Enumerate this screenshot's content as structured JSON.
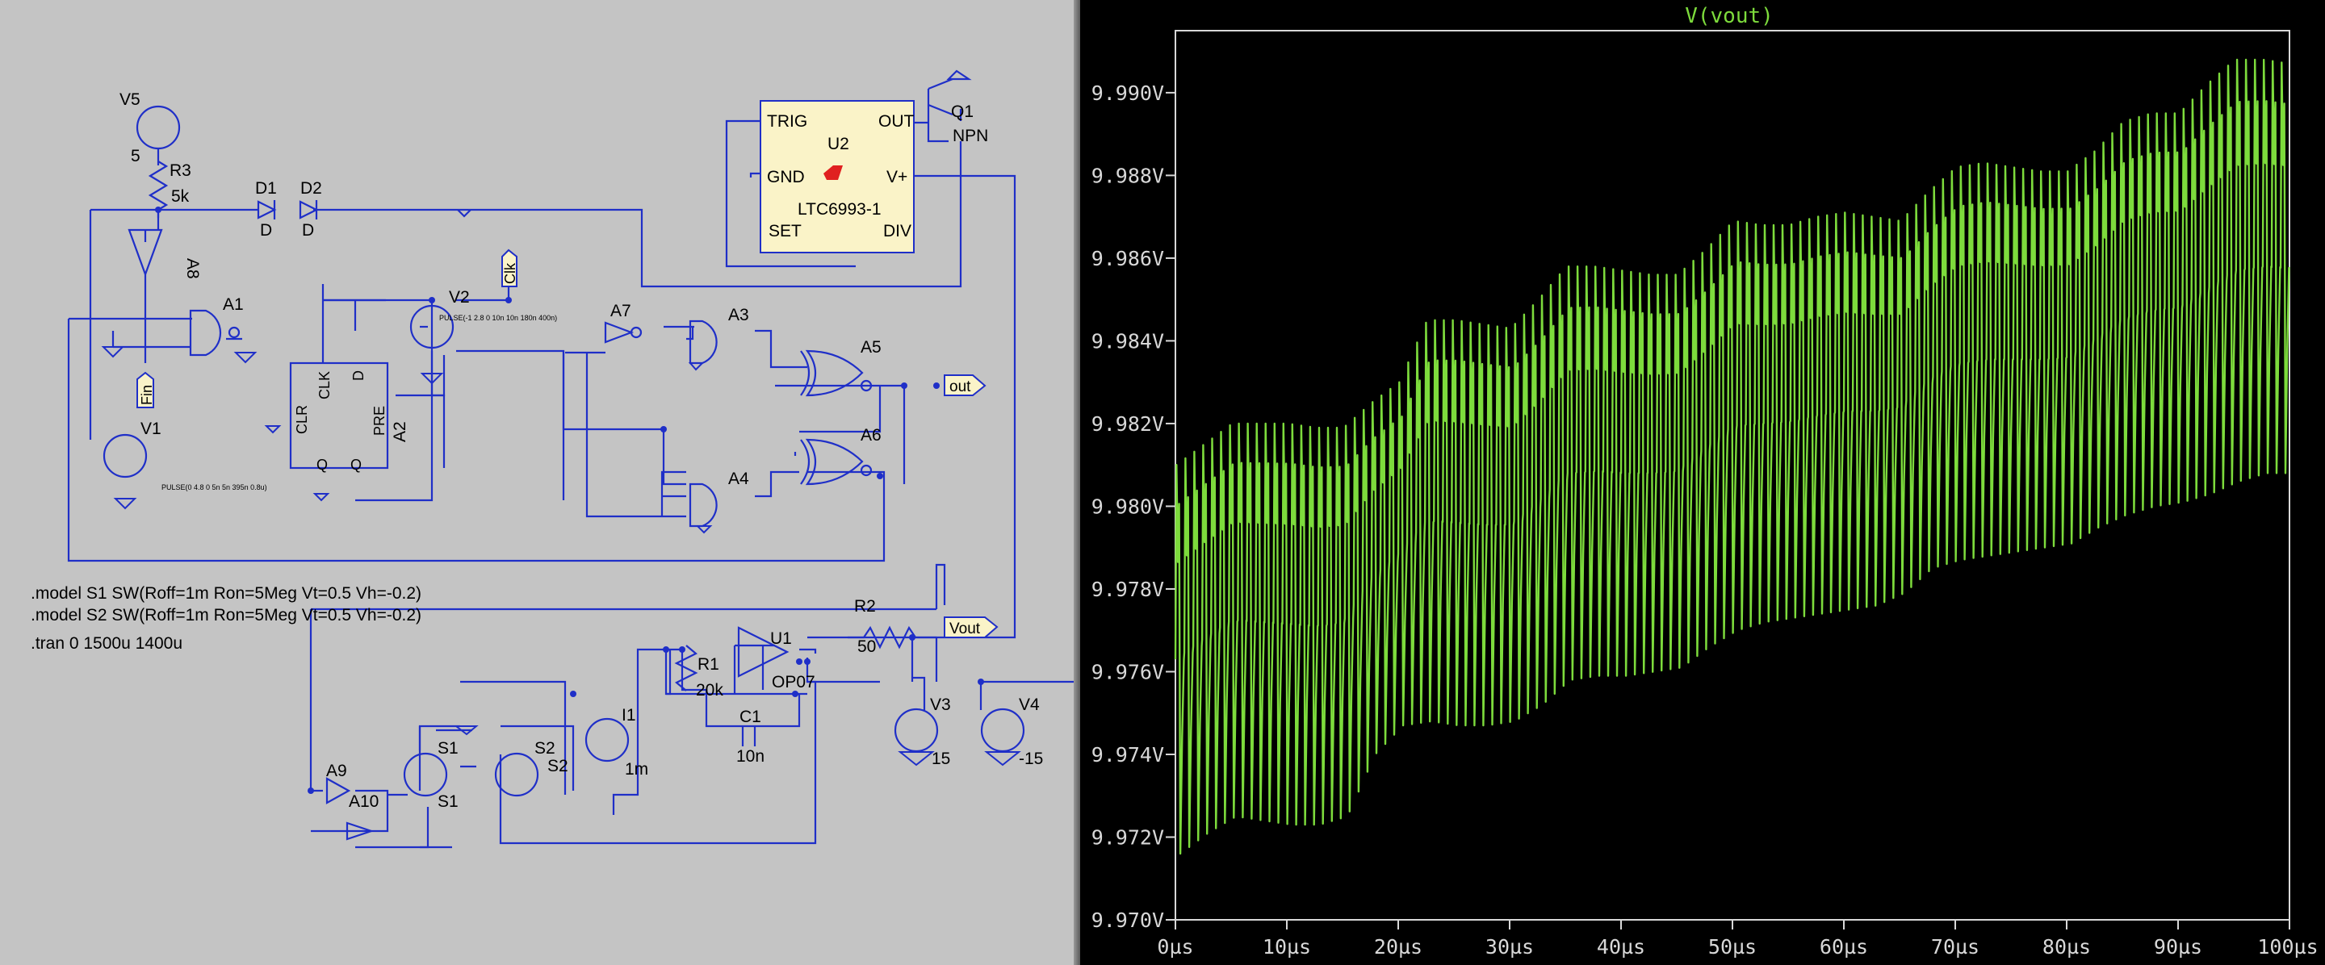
{
  "schematic": {
    "directives": [
      ".model S1 SW(Roff=1m Ron=5Meg Vt=0.5 Vh=-0.2)",
      ".model S2 SW(Roff=1m Ron=5Meg Vt=0.5 Vh=-0.2)",
      ".tran 0 1500u 1400u"
    ],
    "labels": {
      "v5": "V5",
      "v5_val": "5",
      "r3": "R3",
      "r3_val": "5k",
      "d1": "D1",
      "d1_val": "D",
      "d2": "D2",
      "d2_val": "D",
      "a8": "A8",
      "a1": "A1",
      "v2": "V2",
      "v2_src": "PULSE(-1 2.8 0 10n 10n 180n 400n)",
      "clk": "Clk",
      "clk_pin": "CLK",
      "d_pin": "D",
      "clr_pin": "CLR",
      "pre_pin": "PRE",
      "q_pin": "Q",
      "qbar_pin": "Q",
      "a2": "A2",
      "a7": "A7",
      "a3": "A3",
      "a4": "A4",
      "a5": "A5",
      "a6": "A6",
      "fin": "Fin",
      "v1": "V1",
      "v1_src": "PULSE(0 4.8 0 5n 5n 395n 0.8u)",
      "out": "out",
      "u2": "U2",
      "u2_part": "LTC6993-1",
      "trig": "TRIG",
      "gnd": "GND",
      "set": "SET",
      "out_pin": "OUT",
      "vplus": "V+",
      "div": "DIV",
      "q1": "Q1",
      "npn": "NPN",
      "r2": "R2",
      "r2_val": "50",
      "vout": "Vout",
      "r1": "R1",
      "r1_val": "20k",
      "u1": "U1",
      "op07": "OP07",
      "c1": "C1",
      "c1_val": "10n",
      "v3": "V3",
      "v3_val": "15",
      "v4": "V4",
      "v4_val": "-15",
      "i1": "I1",
      "i1_val": "1m",
      "s1": "S1",
      "s1_model": "S1",
      "s2": "S2",
      "s2_model": "S2",
      "a9": "A9",
      "a10": "A10"
    }
  },
  "plot": {
    "title": "V(vout)",
    "colors": {
      "trace": "#7ddb3c",
      "background": "#000000",
      "axis": "#d8d8d8",
      "title": "#7ddb3c"
    }
  },
  "chart_data": {
    "type": "line",
    "title": "V(vout)",
    "xlabel": "",
    "ylabel": "",
    "xlim": [
      0,
      100
    ],
    "ylim": [
      9.97,
      9.9915
    ],
    "x_ticks": [
      "0µs",
      "10µs",
      "20µs",
      "30µs",
      "40µs",
      "50µs",
      "60µs",
      "70µs",
      "80µs",
      "90µs",
      "100µs"
    ],
    "y_ticks": [
      "9.990V",
      "9.988V",
      "9.986V",
      "9.984V",
      "9.982V",
      "9.980V",
      "9.978V",
      "9.976V",
      "9.974V",
      "9.972V",
      "9.970V"
    ],
    "series": [
      {
        "period_us": 0.8,
        "x": [
          0,
          2.5,
          5,
          7.5,
          10,
          12.5,
          15,
          17.5,
          20,
          22.5,
          25,
          27.5,
          30,
          32.5,
          35,
          37.5,
          40,
          42.5,
          45,
          47.5,
          50,
          52.5,
          55,
          57.5,
          60,
          62.5,
          65,
          67.5,
          70,
          72.5,
          75,
          77.5,
          80,
          82.5,
          85,
          87.5,
          90,
          92.5,
          95,
          97.5,
          100
        ],
        "upper": [
          9.981,
          9.9815,
          9.982,
          9.982,
          9.982,
          9.9819,
          9.9819,
          9.9825,
          9.983,
          9.9845,
          9.9845,
          9.9844,
          9.9843,
          9.985,
          9.9858,
          9.9858,
          9.9857,
          9.9856,
          9.9856,
          9.9862,
          9.9869,
          9.9868,
          9.9868,
          9.987,
          9.9871,
          9.987,
          9.9869,
          9.9876,
          9.9882,
          9.9883,
          9.9882,
          9.9881,
          9.9881,
          9.9886,
          9.9893,
          9.9895,
          9.9895,
          9.9902,
          9.9908,
          9.9908,
          9.9907
        ],
        "lower": [
          9.9716,
          9.9721,
          9.9725,
          9.9724,
          9.9723,
          9.9723,
          9.9725,
          9.974,
          9.9747,
          9.9748,
          9.9747,
          9.9747,
          9.9748,
          9.9752,
          9.9758,
          9.9759,
          9.9759,
          9.976,
          9.9761,
          9.9766,
          9.977,
          9.9772,
          9.9773,
          9.9774,
          9.9775,
          9.9776,
          9.9779,
          9.9785,
          9.9787,
          9.9788,
          9.9789,
          9.979,
          9.9791,
          9.9795,
          9.9798,
          9.98,
          9.9801,
          9.9803,
          9.9806,
          9.9808,
          9.9808
        ]
      }
    ]
  }
}
